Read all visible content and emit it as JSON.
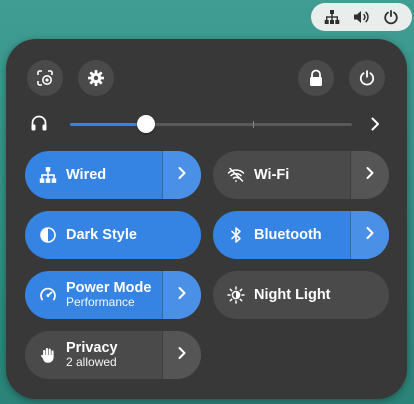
{
  "topbar": {
    "tray_icons": [
      "network-wired-icon",
      "volume-icon",
      "power-icon"
    ]
  },
  "quick_settings": {
    "header_buttons": {
      "left": [
        "screenshot-icon",
        "settings-icon"
      ],
      "right": [
        "lock-icon",
        "power-icon"
      ]
    },
    "volume": {
      "icon": "headphones-icon",
      "level": 0.27,
      "boost_mark": 0.65
    },
    "toggles": [
      {
        "key": "wired",
        "title": "Wired",
        "subtitle": "",
        "icon": "network-wired-icon",
        "active": true,
        "has_menu": true
      },
      {
        "key": "wifi",
        "title": "Wi-Fi",
        "subtitle": "",
        "icon": "wifi-disabled-icon",
        "active": false,
        "has_menu": true
      },
      {
        "key": "dark",
        "title": "Dark Style",
        "subtitle": "",
        "icon": "dark-style-icon",
        "active": true,
        "has_menu": false
      },
      {
        "key": "bluetooth",
        "title": "Bluetooth",
        "subtitle": "",
        "icon": "bluetooth-icon",
        "active": true,
        "has_menu": true
      },
      {
        "key": "power",
        "title": "Power Mode",
        "subtitle": "Performance",
        "icon": "power-mode-icon",
        "active": true,
        "has_menu": true
      },
      {
        "key": "night",
        "title": "Night Light",
        "subtitle": "",
        "icon": "night-light-icon",
        "active": false,
        "has_menu": false
      },
      {
        "key": "privacy",
        "title": "Privacy",
        "subtitle": "2 allowed",
        "icon": "privacy-hand-icon",
        "active": false,
        "has_menu": true
      }
    ]
  },
  "colors": {
    "accent": "#3584e4",
    "panel": "#383838",
    "button": "#4a4a4a",
    "desktop": "#2f8a7f"
  }
}
